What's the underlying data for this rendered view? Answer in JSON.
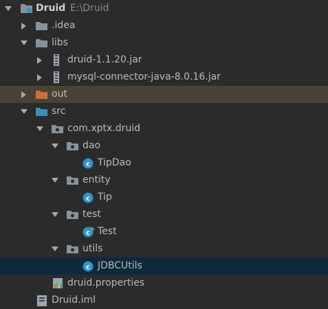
{
  "tree": {
    "root": {
      "label": "Druid",
      "path": "E:\\Druid",
      "icon": "module-folder-icon"
    },
    "idea": {
      "label": ".idea",
      "icon": "folder-icon"
    },
    "libs": {
      "label": "libs",
      "icon": "folder-icon"
    },
    "jar1": {
      "label": "druid-1.1.20.jar",
      "icon": "jar-icon"
    },
    "jar2": {
      "label": "mysql-connector-java-8.0.16.jar",
      "icon": "jar-icon"
    },
    "out": {
      "label": "out",
      "icon": "excluded-folder-icon",
      "color": "#c7733a"
    },
    "src": {
      "label": "src",
      "icon": "source-folder-icon",
      "color": "#3d8fb3"
    },
    "pkg": {
      "label": "com.xptx.druid",
      "icon": "package-icon"
    },
    "dao": {
      "label": "dao",
      "icon": "package-icon"
    },
    "tipdao": {
      "label": "TipDao",
      "icon": "class-icon"
    },
    "entity": {
      "label": "entity",
      "icon": "package-icon"
    },
    "tip": {
      "label": "Tip",
      "icon": "class-icon"
    },
    "test": {
      "label": "test",
      "icon": "package-icon"
    },
    "testclass": {
      "label": "Test",
      "icon": "runnable-class-icon"
    },
    "utils": {
      "label": "utils",
      "icon": "package-icon"
    },
    "jdbcutils": {
      "label": "JDBCUtils",
      "icon": "class-icon"
    },
    "props": {
      "label": "druid.properties",
      "icon": "properties-file-icon"
    },
    "iml": {
      "label": "Druid.iml",
      "icon": "iml-file-icon"
    }
  }
}
